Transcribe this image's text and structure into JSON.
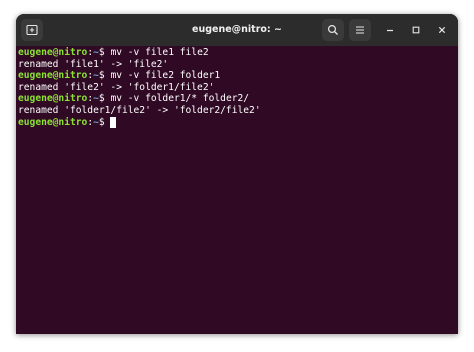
{
  "window": {
    "title": "eugene@nitro: ~"
  },
  "titlebar": {
    "new_tab_icon": "new-tab-icon",
    "search_icon": "search-icon",
    "menu_icon": "hamburger-menu-icon",
    "minimize_icon": "minimize-icon",
    "maximize_icon": "maximize-icon",
    "close_icon": "close-icon"
  },
  "colors": {
    "terminal_bg": "#300a24",
    "prompt_user": "#8ae234",
    "prompt_path": "#729fcf",
    "titlebar_bg": "#2c2c2c"
  },
  "terminal": {
    "prompt_user": "eugene@nitro",
    "prompt_colon": ":",
    "prompt_path": "~",
    "prompt_sign": "$ ",
    "lines": [
      {
        "type": "command",
        "text": "mv -v file1 file2"
      },
      {
        "type": "output",
        "text": "renamed 'file1' -> 'file2'"
      },
      {
        "type": "command",
        "text": "mv -v file2 folder1"
      },
      {
        "type": "output",
        "text": "renamed 'file2' -> 'folder1/file2'"
      },
      {
        "type": "command",
        "text": "mv -v folder1/* folder2/"
      },
      {
        "type": "output",
        "text": "renamed 'folder1/file2' -> 'folder2/file2'"
      },
      {
        "type": "command",
        "text": ""
      }
    ]
  }
}
